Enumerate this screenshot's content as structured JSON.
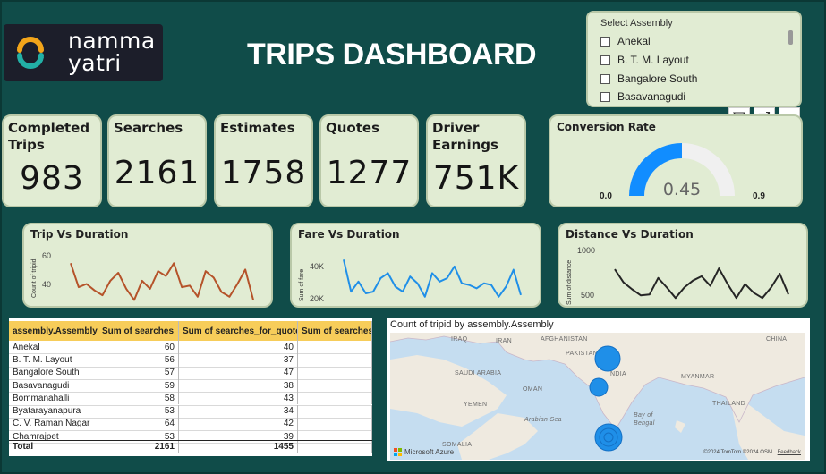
{
  "brand": {
    "line1": "namma",
    "line2": "yatri"
  },
  "title": "TRIPS DASHBOARD",
  "slicer": {
    "title": "Select Assembly",
    "items": [
      "Anekal",
      "B. T. M. Layout",
      "Bangalore South",
      "Basavanagudi"
    ]
  },
  "kpis": [
    {
      "label": "Completed Trips",
      "value": "983"
    },
    {
      "label": "Searches",
      "value": "2161"
    },
    {
      "label": "Estimates",
      "value": "1758"
    },
    {
      "label": "Quotes",
      "value": "1277"
    },
    {
      "label": "Driver Earnings",
      "value": "751K"
    }
  ],
  "gauge": {
    "title": "Conversion Rate",
    "value": 0.45,
    "value_label": "0.45",
    "min": 0.0,
    "max": 0.9,
    "min_label": "0.0",
    "max_label": "0.9",
    "fill_color": "#118dff",
    "track_color": "#f0f0f0"
  },
  "chart_data": [
    {
      "type": "line",
      "title": "Trip Vs Duration",
      "ylabel": "Count of tripid",
      "yticks": [
        "60",
        "40"
      ],
      "ylim": [
        28,
        66
      ],
      "color": "#b5532a",
      "values": [
        53,
        38,
        40,
        36,
        33,
        42,
        47,
        37,
        30,
        42,
        37,
        48,
        45,
        53,
        38,
        39,
        32,
        48,
        44,
        35,
        32,
        40,
        49,
        30
      ]
    },
    {
      "type": "line",
      "title": "Fare Vs Duration",
      "ylabel": "Sum of fare",
      "yticks": [
        "40K",
        "20K"
      ],
      "ylim": [
        17000,
        52000
      ],
      "color": "#1f8fe8",
      "values": [
        46000,
        27000,
        33000,
        26000,
        27000,
        35000,
        38000,
        30000,
        27000,
        36000,
        32000,
        24000,
        38000,
        33000,
        35000,
        42000,
        32000,
        31000,
        29000,
        32000,
        31000,
        24000,
        30000,
        40000,
        25000
      ]
    },
    {
      "type": "line",
      "title": "Distance Vs Duration",
      "ylabel": "Sum of distance",
      "yticks": [
        "1000",
        "500"
      ],
      "ylim": [
        380,
        1080
      ],
      "color": "#252525",
      "values": [
        770,
        620,
        540,
        470,
        480,
        670,
        560,
        440,
        560,
        640,
        690,
        580,
        780,
        600,
        440,
        600,
        500,
        440,
        560,
        720,
        480
      ]
    }
  ],
  "table": {
    "headers": [
      "assembly.Assembly",
      "Sum of searches",
      "Sum of searches_for_quotes",
      "Sum of searches_g"
    ],
    "rows": [
      [
        "Anekal",
        "60",
        "40",
        ""
      ],
      [
        "B. T. M. Layout",
        "56",
        "37",
        ""
      ],
      [
        "Bangalore South",
        "57",
        "47",
        ""
      ],
      [
        "Basavanagudi",
        "59",
        "38",
        ""
      ],
      [
        "Bommanahalli",
        "58",
        "43",
        ""
      ],
      [
        "Byatarayanapura",
        "53",
        "34",
        ""
      ],
      [
        "C. V. Raman Nagar",
        "64",
        "42",
        ""
      ],
      [
        "Chamrajpet",
        "53",
        "39",
        ""
      ]
    ],
    "total": [
      "Total",
      "2161",
      "1455",
      ""
    ]
  },
  "map": {
    "title": "Count of tripid by assembly.Assembly",
    "labels": [
      "IRAQ",
      "IRAN",
      "AFGHANISTAN",
      "PAKISTAN",
      "SAUDI ARABIA",
      "OMAN",
      "YEMEN",
      "NDIA",
      "MYANMAR",
      "THAILAND",
      "Arabian Sea",
      "Bay of Bengal",
      "SOMALIA",
      "CHINA"
    ],
    "attribution": "©2024 TomTom  ©2024 OSM",
    "feedback": "Feedback",
    "provider": "Microsoft Azure"
  },
  "colors": {
    "background": "#104c49",
    "card": "#e1ecd3",
    "table_header": "#f7cd5a",
    "bubble": "#1f8fe8"
  }
}
